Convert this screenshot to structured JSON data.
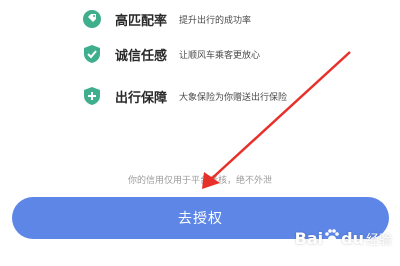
{
  "features": [
    {
      "icon": "tag-icon",
      "title": "高匹配率",
      "desc": "提升出行的成功率",
      "color": "#3fae8c"
    },
    {
      "icon": "shield-check-icon",
      "title": "诚信任感",
      "desc": "让顺风车乘客更放心",
      "color": "#3fae8c"
    },
    {
      "icon": "shield-plus-icon",
      "title": "出行保障",
      "desc": "大象保险为你赠送出行保险",
      "color": "#3fae8c"
    }
  ],
  "notice": "你的信用仅用于平台考核，绝不外泄",
  "button": {
    "label": "去授权",
    "color": "#5e86e6"
  },
  "watermark": {
    "brand": "Bai",
    "brand_end": "du",
    "sub": "经验"
  }
}
